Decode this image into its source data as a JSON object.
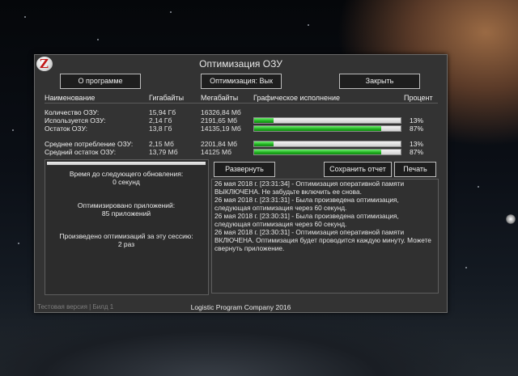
{
  "window": {
    "title": "Оптимизация ОЗУ",
    "logo_letter": "Z"
  },
  "toolbar": {
    "about_label": "О программе",
    "optimization_label": "Оптимизация: Вык",
    "close_label": "Закрыть"
  },
  "columns": {
    "name": "Наименование",
    "gigabytes": "Гигабайты",
    "megabytes": "Мегабайты",
    "graphic": "Графическое исполнение",
    "percent": "Процент"
  },
  "stats": {
    "total": {
      "label": "Количество ОЗУ:",
      "gb": "15,94 Гб",
      "mb": "16326,84 Мб"
    },
    "used": {
      "label": "Используется ОЗУ:",
      "gb": "2,14 Гб",
      "mb": "2191,65 Мб",
      "percent": "13%",
      "fraction": 0.13
    },
    "free": {
      "label": "Остаток ОЗУ:",
      "gb": "13,8 Гб",
      "mb": "14135,19 Мб",
      "percent": "87%",
      "fraction": 0.87
    },
    "avg_used": {
      "label": "Среднее потребление ОЗУ:",
      "gb": "2,15 Мб",
      "mb": "2201,84 Мб",
      "percent": "13%",
      "fraction": 0.13
    },
    "avg_free": {
      "label": "Средний остаток ОЗУ:",
      "gb": "13,79 Мб",
      "mb": "14125 Мб",
      "percent": "87%",
      "fraction": 0.87
    }
  },
  "info": {
    "next_update_label": "Время до следующего обновления:",
    "next_update_value": "0 секунд",
    "optimized_apps_label": "Оптимизировано приложений:",
    "optimized_apps_value": "85 приложений",
    "optimizations_label": "Произведено оптимизаций за эту сессию:",
    "optimizations_value": "2 раз"
  },
  "log_controls": {
    "expand_label": "Развернуть",
    "save_label": "Сохранить отчет",
    "print_label": "Печать"
  },
  "log": [
    "26 мая 2018 г. [23:31:34] - Оптимизация оперативной памяти",
    "ВЫКЛЮЧЕНА. Не забудьте включить ее снова.",
    "26 мая 2018 г. [23:31:31] - Была произведена оптимизация,",
    "следующая оптимизация через 60 секунд.",
    "26 мая 2018 г. [23:30:31] - Была произведена оптимизация,",
    "следующая оптимизация через 60 секунд.",
    "26 мая 2018 г. [23:30:31] - Оптимизация оперативной памяти",
    "ВКЛЮЧЕНА. Оптимизация будет проводится каждую минуту. Можете",
    "свернуть приложение."
  ],
  "footer": {
    "version": "Тестовая версия | Билд 1",
    "company": "Logistic Program Company 2016"
  },
  "colors": {
    "bar_fill": "#1fae1f",
    "window_bg": "#333333"
  }
}
